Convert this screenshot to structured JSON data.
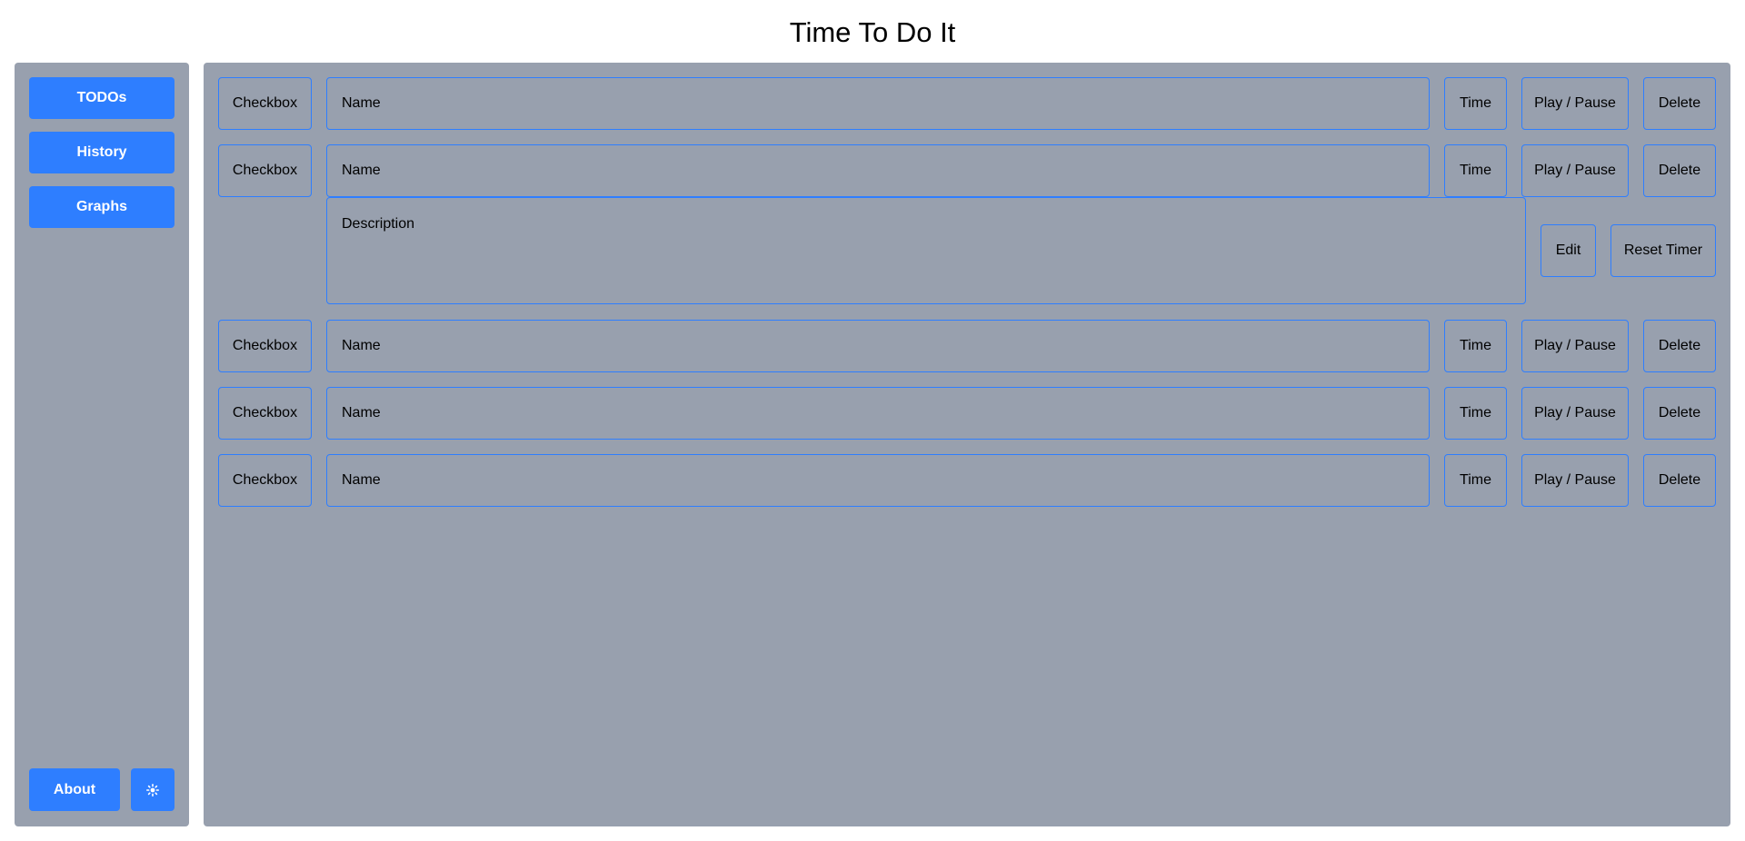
{
  "app": {
    "title": "Time To Do It"
  },
  "sidebar": {
    "nav": [
      {
        "label": "TODOs"
      },
      {
        "label": "History"
      },
      {
        "label": "Graphs"
      }
    ],
    "about_label": "About",
    "theme_icon": "sun-icon"
  },
  "todos": [
    {
      "checkbox": "Checkbox",
      "name": "Name",
      "time": "Time",
      "play_pause": "Play / Pause",
      "delete": "Delete"
    },
    {
      "checkbox": "Checkbox",
      "name": "Name",
      "time": "Time",
      "play_pause": "Play / Pause",
      "delete": "Delete",
      "expanded": {
        "description": "Description",
        "edit": "Edit",
        "reset_timer": "Reset Timer"
      }
    },
    {
      "checkbox": "Checkbox",
      "name": "Name",
      "time": "Time",
      "play_pause": "Play / Pause",
      "delete": "Delete"
    },
    {
      "checkbox": "Checkbox",
      "name": "Name",
      "time": "Time",
      "play_pause": "Play / Pause",
      "delete": "Delete"
    },
    {
      "checkbox": "Checkbox",
      "name": "Name",
      "time": "Time",
      "play_pause": "Play / Pause",
      "delete": "Delete"
    }
  ],
  "colors": {
    "accent": "#2e7eff",
    "panel": "#98a0ae",
    "background": "#ffffff"
  }
}
